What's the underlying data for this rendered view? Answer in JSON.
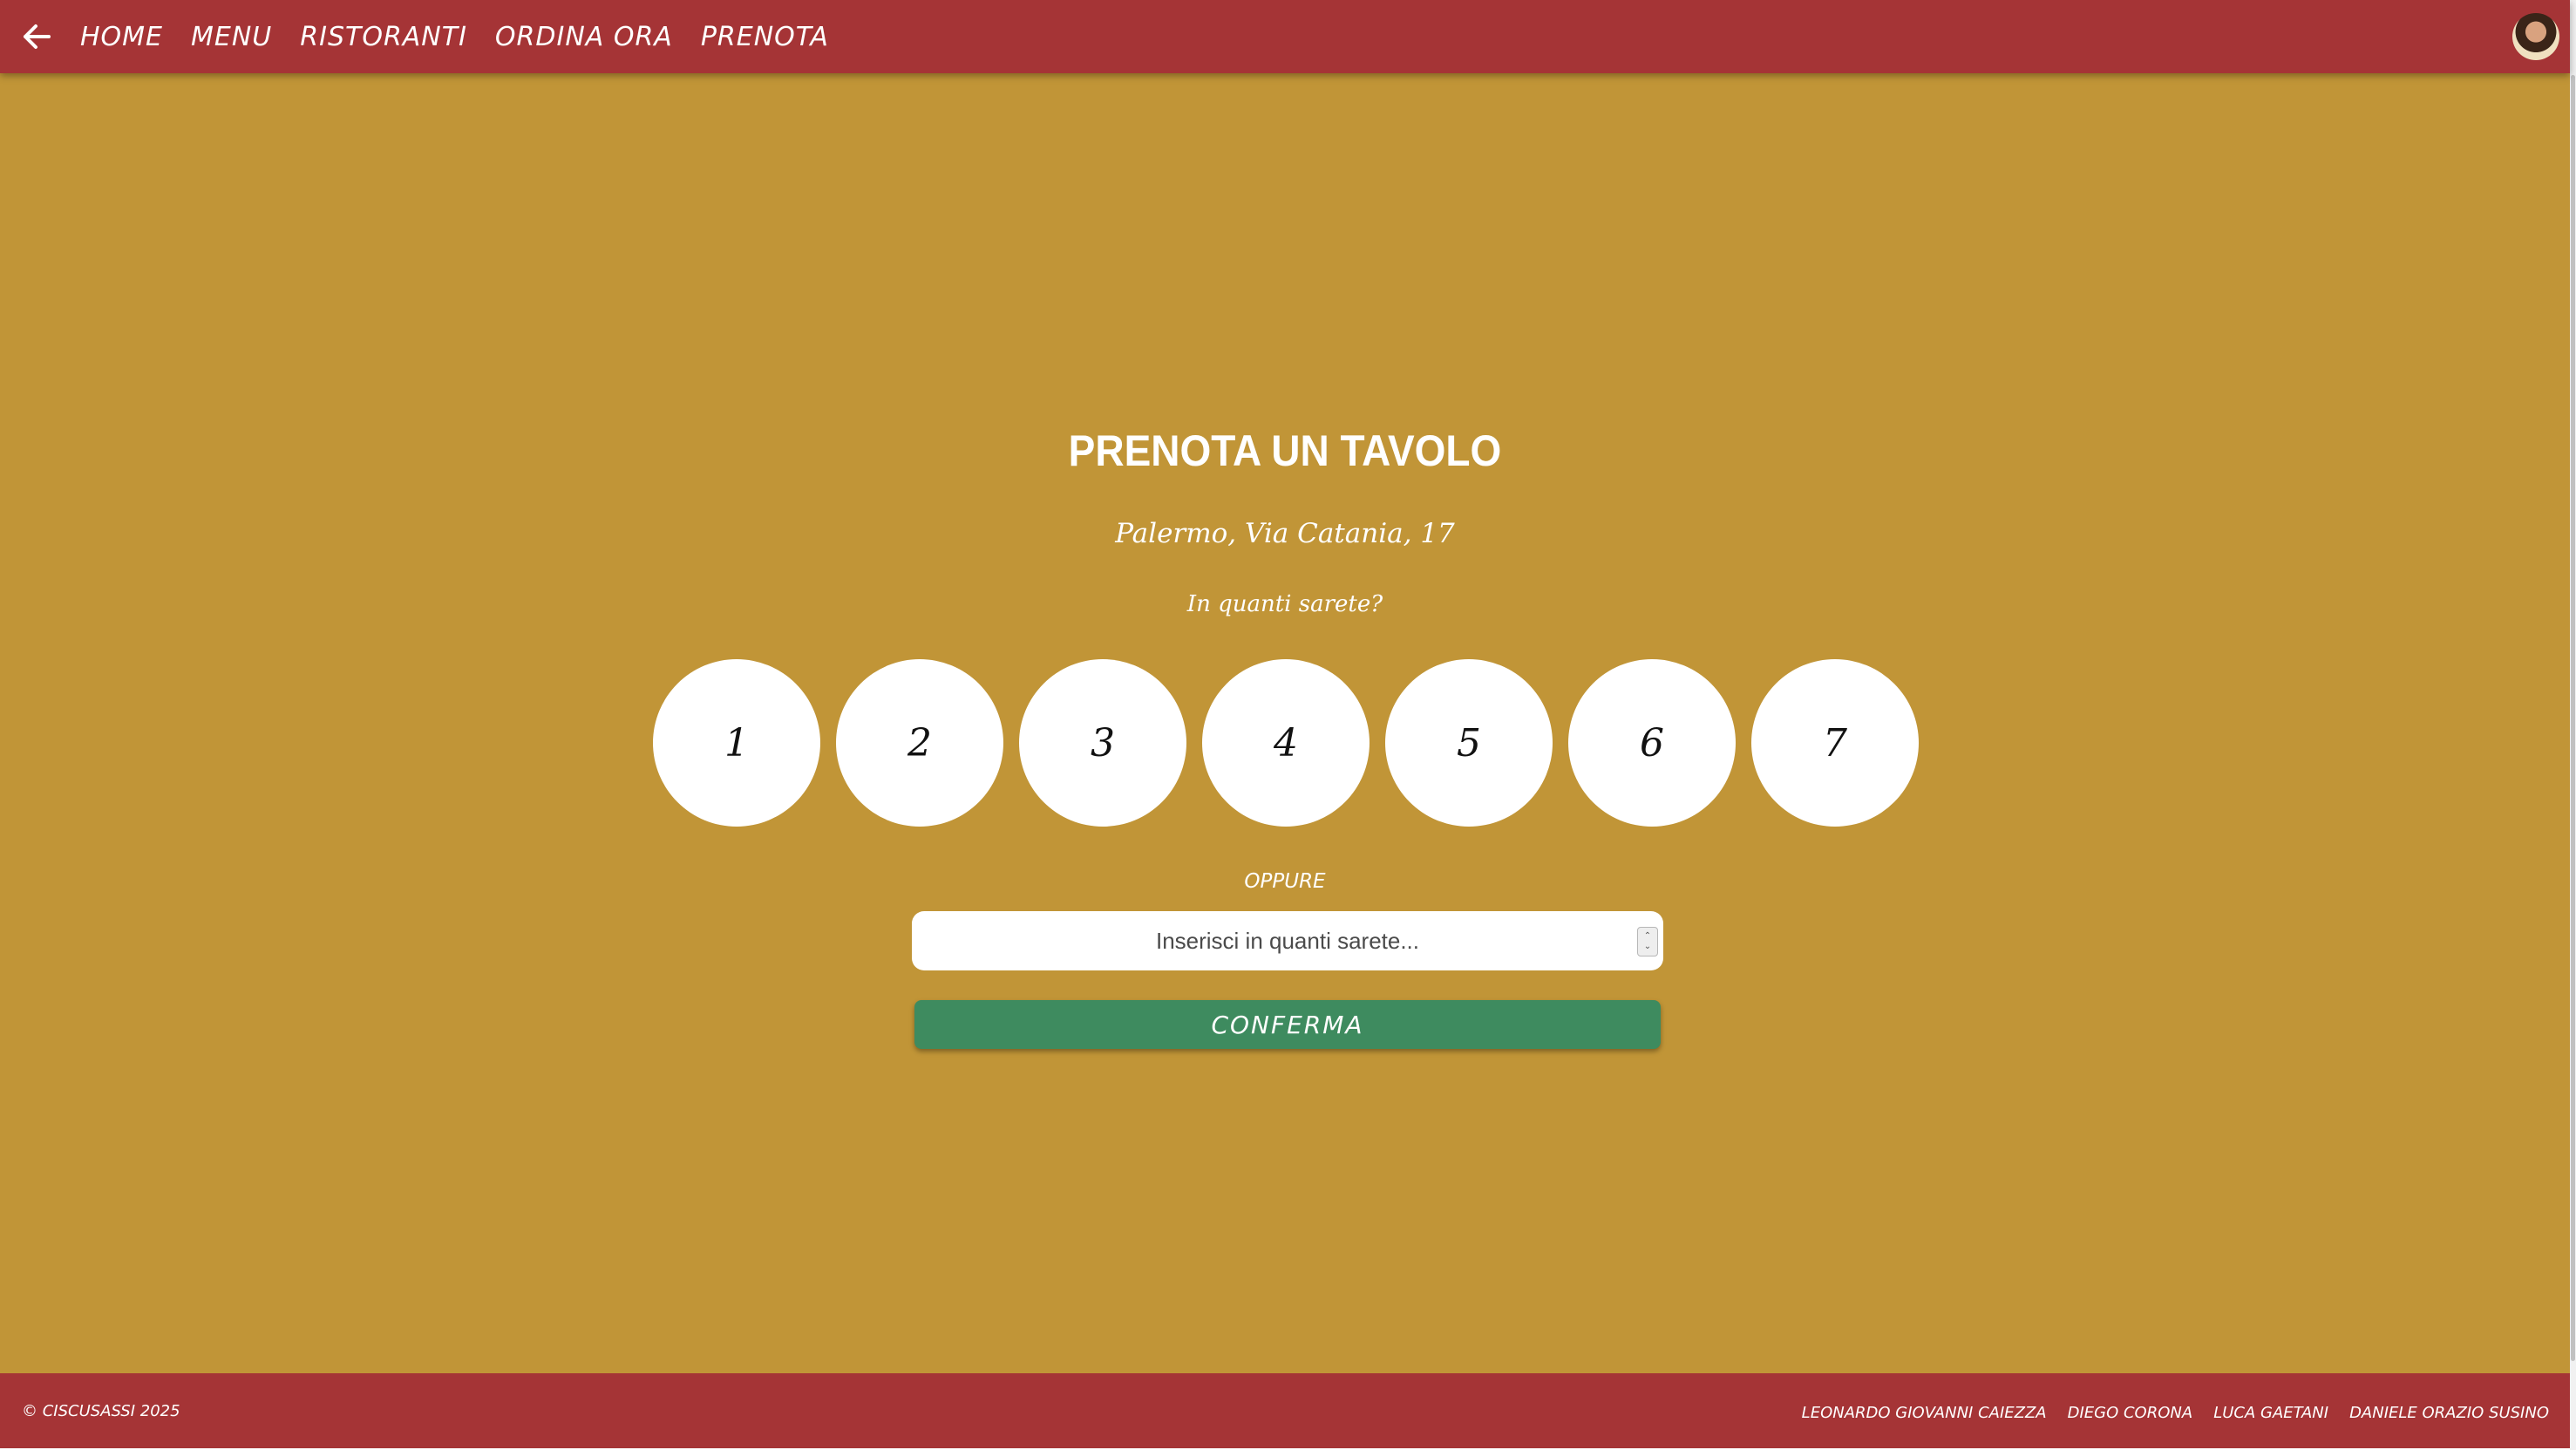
{
  "header": {
    "back_icon": "arrow-left-icon",
    "nav": [
      "HOME",
      "MENU",
      "RISTORANTI",
      "ORDINA ORA",
      "PRENOTA"
    ],
    "avatar_icon": "user-avatar"
  },
  "main": {
    "title": "PRENOTA UN TAVOLO",
    "address": "Palermo, Via Catania, 17",
    "question": "In quanti sarete?",
    "guest_options": [
      "1",
      "2",
      "3",
      "4",
      "5",
      "6",
      "7"
    ],
    "or_label": "OPPURE",
    "input_placeholder": "Inserisci in quanti sarete...",
    "input_value": "",
    "confirm_label": "CONFERMA"
  },
  "footer": {
    "copyright": "© CISCUSASSI 2025",
    "authors": [
      "LEONARDO GIOVANNI CAIEZZA",
      "DIEGO CORONA",
      "LUCA GAETANI",
      "DANIELE ORAZIO SUSINO"
    ]
  },
  "colors": {
    "header_footer": "#a53436",
    "background": "#c19537",
    "confirm_button": "#3e8b5f",
    "text": "#ffffff"
  }
}
